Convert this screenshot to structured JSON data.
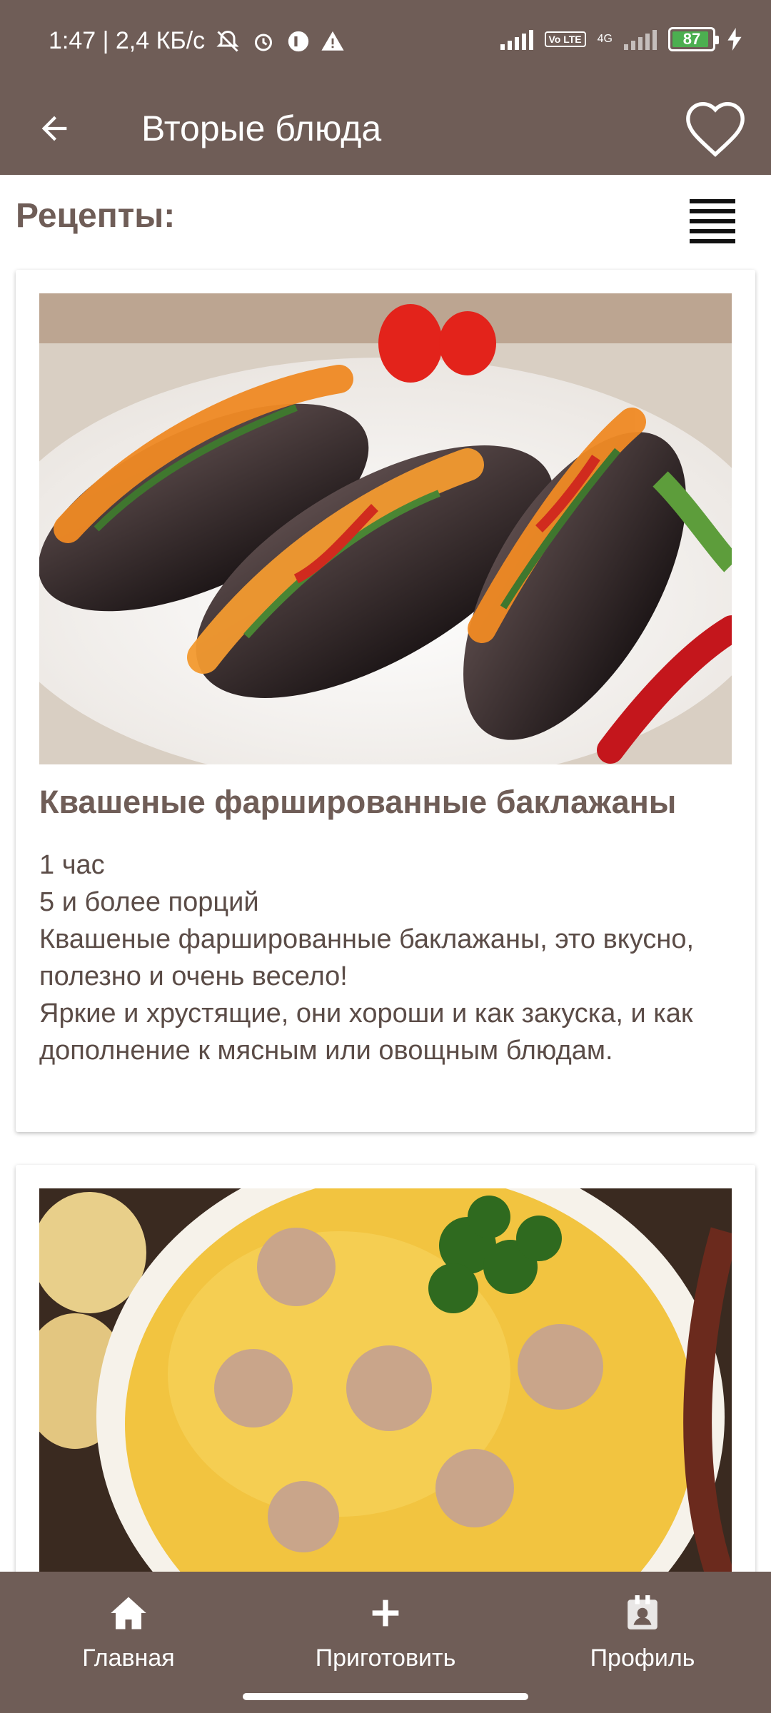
{
  "status_bar": {
    "time_speed": "1:47 | 2,4 КБ/с",
    "network": "4G",
    "volte": "Vo LTE",
    "battery": "87"
  },
  "app_bar": {
    "title": "Вторые блюда"
  },
  "section": {
    "title": "Рецепты:"
  },
  "recipes": [
    {
      "title": "Квашеные фаршированные баклажаны",
      "time": "1 час",
      "servings": "5 и более порций",
      "description_1": "Квашеные фаршированные баклажаны, это вкусно, полезно и очень весело!",
      "description_2": "Яркие и хрустящие, они хороши и как закуска, и как дополнение к мясным или овощным блюдам."
    },
    {
      "title": "",
      "time": "",
      "servings": ""
    }
  ],
  "bottom_nav": {
    "home": "Главная",
    "cook": "Приготовить",
    "profile": "Профиль"
  },
  "colors": {
    "primary": "#6f5d57",
    "text": "#5b4c47"
  }
}
